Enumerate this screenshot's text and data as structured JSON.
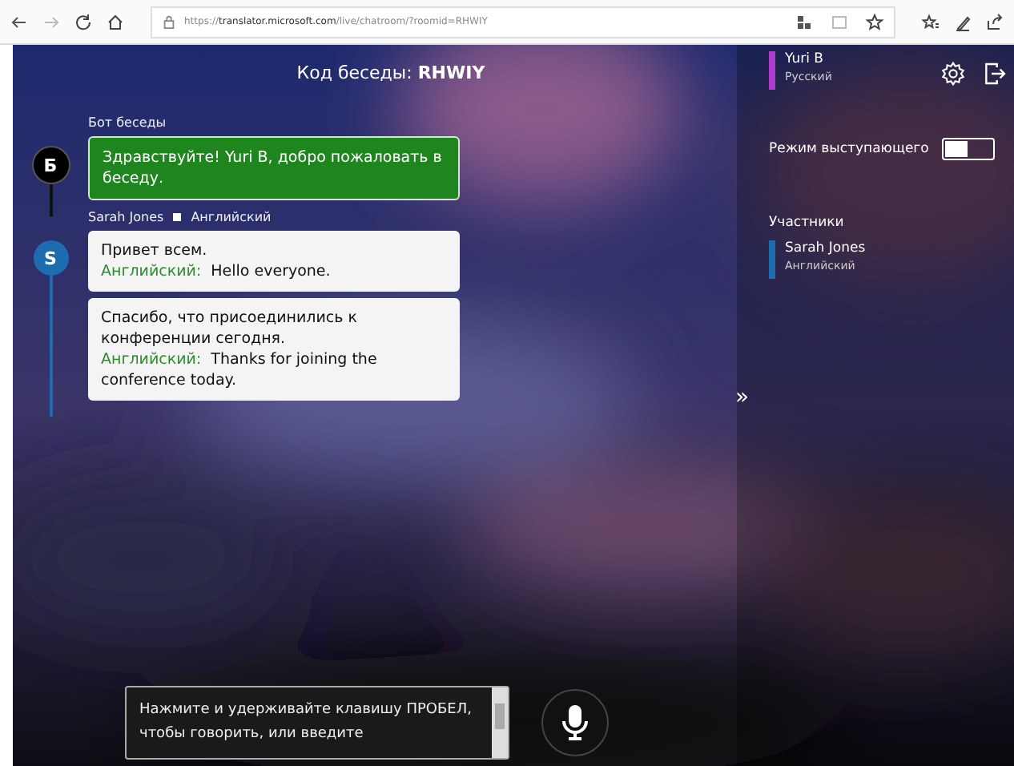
{
  "browser": {
    "url_prefix": "https://",
    "url_host": "translator.microsoft.com",
    "url_path": "/live/chatroom/?roomid=RHWIY"
  },
  "header": {
    "label": "Код беседы:",
    "code": "RHWIY"
  },
  "messages": [
    {
      "kind": "bot",
      "sender": "Бот беседы",
      "avatar": "Б",
      "bubbles": [
        {
          "text": "Здравствуйте! Yuri B, добро пожаловать в беседу."
        }
      ]
    },
    {
      "kind": "user",
      "sender": "Sarah Jones",
      "language": "Английский",
      "avatar": "S",
      "color": "#1e6cb0",
      "bubbles": [
        {
          "text": "Привет всем.",
          "translation_label": "Английский:",
          "translation": "Hello everyone."
        },
        {
          "text": "Спасибо, что присоединились к конференции сегодня.",
          "translation_label": "Английский:",
          "translation": "Thanks for joining the conference today."
        }
      ]
    }
  ],
  "input": {
    "placeholder": "Нажмите и удерживайте клавишу ПРОБЕЛ, чтобы говорить, или введите"
  },
  "collapse_glyph": "»",
  "user": {
    "name": "Yuri B",
    "language": "Русский",
    "color": "#b03cd0"
  },
  "presenter_mode": {
    "label": "Режим выступающего",
    "on": false
  },
  "participants": {
    "title": "Участники",
    "items": [
      {
        "name": "Sarah Jones",
        "language": "Английский",
        "color": "#1e6cb0"
      }
    ]
  }
}
